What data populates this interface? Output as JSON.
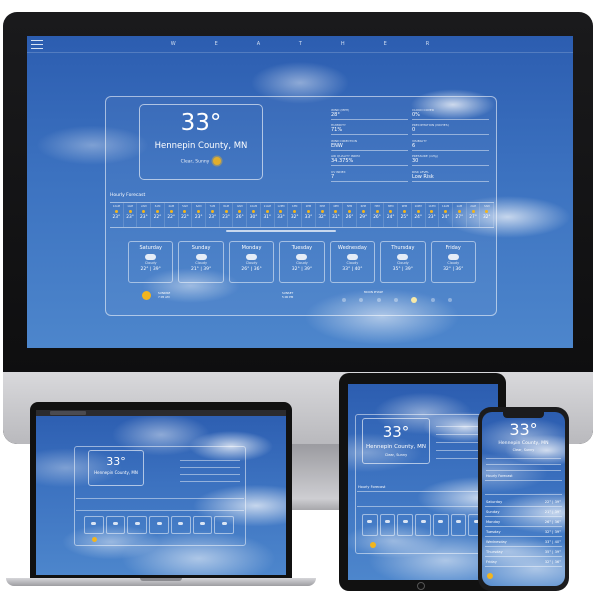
{
  "app": {
    "brand": "WEATHER"
  },
  "current": {
    "temp": "33°",
    "location": "Hennepin County, MN",
    "condition": "Clear, Sunny"
  },
  "stats": [
    {
      "label": "WIND (MPH)",
      "value": "28°"
    },
    {
      "label": "CLOUD COVER",
      "value": "0%"
    },
    {
      "label": "HUMIDITY",
      "value": "71%"
    },
    {
      "label": "PRECIPITATION (INCHES)",
      "value": "0"
    },
    {
      "label": "WIND DIRECTION",
      "value": "ENW"
    },
    {
      "label": "VISIBILITY",
      "value": "6"
    },
    {
      "label": "AIR QUALITY INDEX",
      "value": "34.375%"
    },
    {
      "label": "PRESSURE (inHg)",
      "value": "30"
    },
    {
      "label": "UV INDEX",
      "value": "7"
    },
    {
      "label": "RISK LEVEL",
      "value": "Low Risk"
    }
  ],
  "hourly": {
    "title": "Hourly Forecast",
    "hours": [
      "12AM",
      "1AM",
      "2AM",
      "3AM",
      "4AM",
      "5AM",
      "6AM",
      "7AM",
      "8AM",
      "9AM",
      "10AM",
      "11AM",
      "12PM",
      "1PM",
      "2PM",
      "3PM",
      "4PM",
      "5PM",
      "6PM",
      "7PM",
      "8PM",
      "9PM",
      "10PM",
      "11PM",
      "12AM",
      "1AM",
      "2AM",
      "3AM"
    ],
    "temps": [
      "23°",
      "23°",
      "23°",
      "22°",
      "22°",
      "22°",
      "23°",
      "23°",
      "23°",
      "26°",
      "30°",
      "31°",
      "33°",
      "32°",
      "33°",
      "32°",
      "31°",
      "26°",
      "29°",
      "26°",
      "24°",
      "25°",
      "24°",
      "23°",
      "24°",
      "27°",
      "27°",
      "32°"
    ]
  },
  "daily": [
    {
      "day": "Saturday",
      "cond": "Cloudy",
      "range": "22° | 39°"
    },
    {
      "day": "Sunday",
      "cond": "Cloudy",
      "range": "21° | 39°"
    },
    {
      "day": "Monday",
      "cond": "Cloudy",
      "range": "26° | 36°"
    },
    {
      "day": "Tuesday",
      "cond": "Cloudy",
      "range": "32° | 39°"
    },
    {
      "day": "Wednesday",
      "cond": "Cloudy",
      "range": "33° | 40°"
    },
    {
      "day": "Thursday",
      "cond": "Cloudy",
      "range": "35° | 39°"
    },
    {
      "day": "Friday",
      "cond": "Cloudy",
      "range": "32° | 36°"
    }
  ],
  "sun": {
    "sunrise_label": "SUNRISE",
    "sunrise_time": "7:05 AM",
    "sunset_label": "SUNSET",
    "sunset_time": "5:00 PM",
    "moon_label": "MOON PHASE"
  },
  "phone": {
    "temp": "33°",
    "location": "Hennepin County, MN",
    "condition": "Clear, Sunny",
    "hourly_title": "Hourly Forecast",
    "daily": [
      {
        "day": "Saturday",
        "range": "22° | 39°"
      },
      {
        "day": "Sunday",
        "range": "21° | 39°"
      },
      {
        "day": "Monday",
        "range": "26° | 36°"
      },
      {
        "day": "Tuesday",
        "range": "32° | 39°"
      },
      {
        "day": "Wednesday",
        "range": "33° | 40°"
      },
      {
        "day": "Thursday",
        "range": "35° | 39°"
      },
      {
        "day": "Friday",
        "range": "32° | 36°"
      }
    ]
  },
  "colors": {
    "sky": "#3c72c0",
    "sun": "#f2b51e",
    "panel_border": "#ffffff"
  }
}
